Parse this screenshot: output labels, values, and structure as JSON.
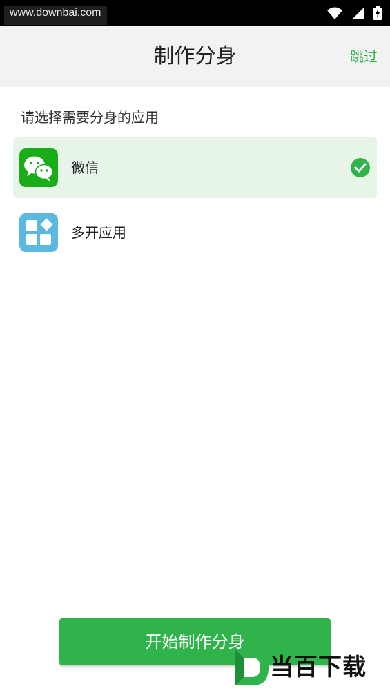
{
  "status_bar": {
    "watermark_url": "www.downbai.com",
    "icons": [
      "wifi-icon",
      "signal-icon",
      "battery-charging-icon"
    ]
  },
  "header": {
    "title": "制作分身",
    "skip_label": "跳过"
  },
  "prompt": "请选择需要分身的应用",
  "apps": [
    {
      "label": "微信",
      "icon": "wechat-icon",
      "selected": true
    },
    {
      "label": "多开应用",
      "icon": "multi-open-app-icon",
      "selected": false
    }
  ],
  "start_button_label": "开始制作分身",
  "colors": {
    "accent": "#2fb34a",
    "selected_bg": "#e6f5e8",
    "header_bg": "#f2f2f2",
    "multi_app_icon": "#5bb8df"
  },
  "logo_watermark": {
    "text": "当百下载",
    "letter": "D"
  }
}
